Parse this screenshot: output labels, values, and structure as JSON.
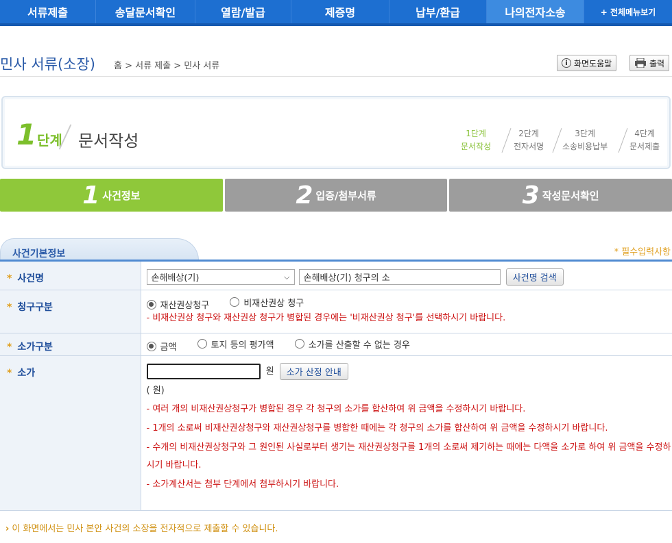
{
  "nav": {
    "items": [
      "서류제출",
      "송달문서확인",
      "열람/발급",
      "제증명",
      "납부/환급",
      "나의전자소송",
      "+ 전체메뉴보기"
    ]
  },
  "header": {
    "title": "민사 서류(소장)",
    "breadcrumb": "홈 > 서류 제출 > 민사 서류",
    "help_label": "화면도움말",
    "print_label": "출력"
  },
  "step": {
    "num": "1",
    "dan": "단계",
    "title": "문서작성",
    "steps": [
      {
        "line1": "1단계",
        "line2": "문서작성"
      },
      {
        "line1": "2단계",
        "line2": "전자서명"
      },
      {
        "line1": "3단계",
        "line2": "소송비용납부"
      },
      {
        "line1": "4단계",
        "line2": "문서제출"
      }
    ]
  },
  "tabs": [
    {
      "num": "1",
      "label": "사건정보"
    },
    {
      "num": "2",
      "label": "입증/첨부서류"
    },
    {
      "num": "3",
      "label": "작성문서확인"
    }
  ],
  "section": {
    "title": "사건기본정보",
    "required_note": "* 필수입력사항"
  },
  "form": {
    "case_name": {
      "label": "사건명",
      "select_value": "손해배상(기)",
      "input_value": "손해배상(기) 청구의 소",
      "search_button": "사건명 검색"
    },
    "claim_type": {
      "label": "청구구분",
      "options": [
        "재산권상청구",
        "비재산권상 청구"
      ],
      "notice": "- 비재산권상 청구와 재산권상 청구가 병합된 경우에는 '비재산권상 청구'를 선택하시기 바랍니다."
    },
    "value_type": {
      "label": "소가구분",
      "options": [
        "금액",
        "토지 등의 평가액",
        "소가를 산출할 수 없는 경우"
      ]
    },
    "amount": {
      "label": "소가",
      "unit": "원",
      "calc_button": "소가 산정 안내",
      "unit_paren": "( 원)",
      "notes": [
        "- 여러 개의 비재산권상청구가 병합된 경우 각 청구의 소가를 합산하여 위 금액을 수정하시기 바랍니다.",
        "- 1개의 소로써 비재산권상청구와 재산권상청구를 병합한 때에는 각 청구의 소가를 합산하여 위 금액을 수정하시기 바랍니다.",
        "- 수개의 비재산권상청구와 그 원인된 사실로부터 생기는 재산권상청구를 1개의 소로써 제기하는 때에는 다액을 소가로 하여 위 금액을 수정하시기 바랍니다.",
        "- 소가계산서는 첨부 단계에서 첨부하시기 바랍니다."
      ]
    }
  },
  "footnote": "이 화면에서는 민사 본안 사건의 소장을 전자적으로 제출할 수 있습니다."
}
